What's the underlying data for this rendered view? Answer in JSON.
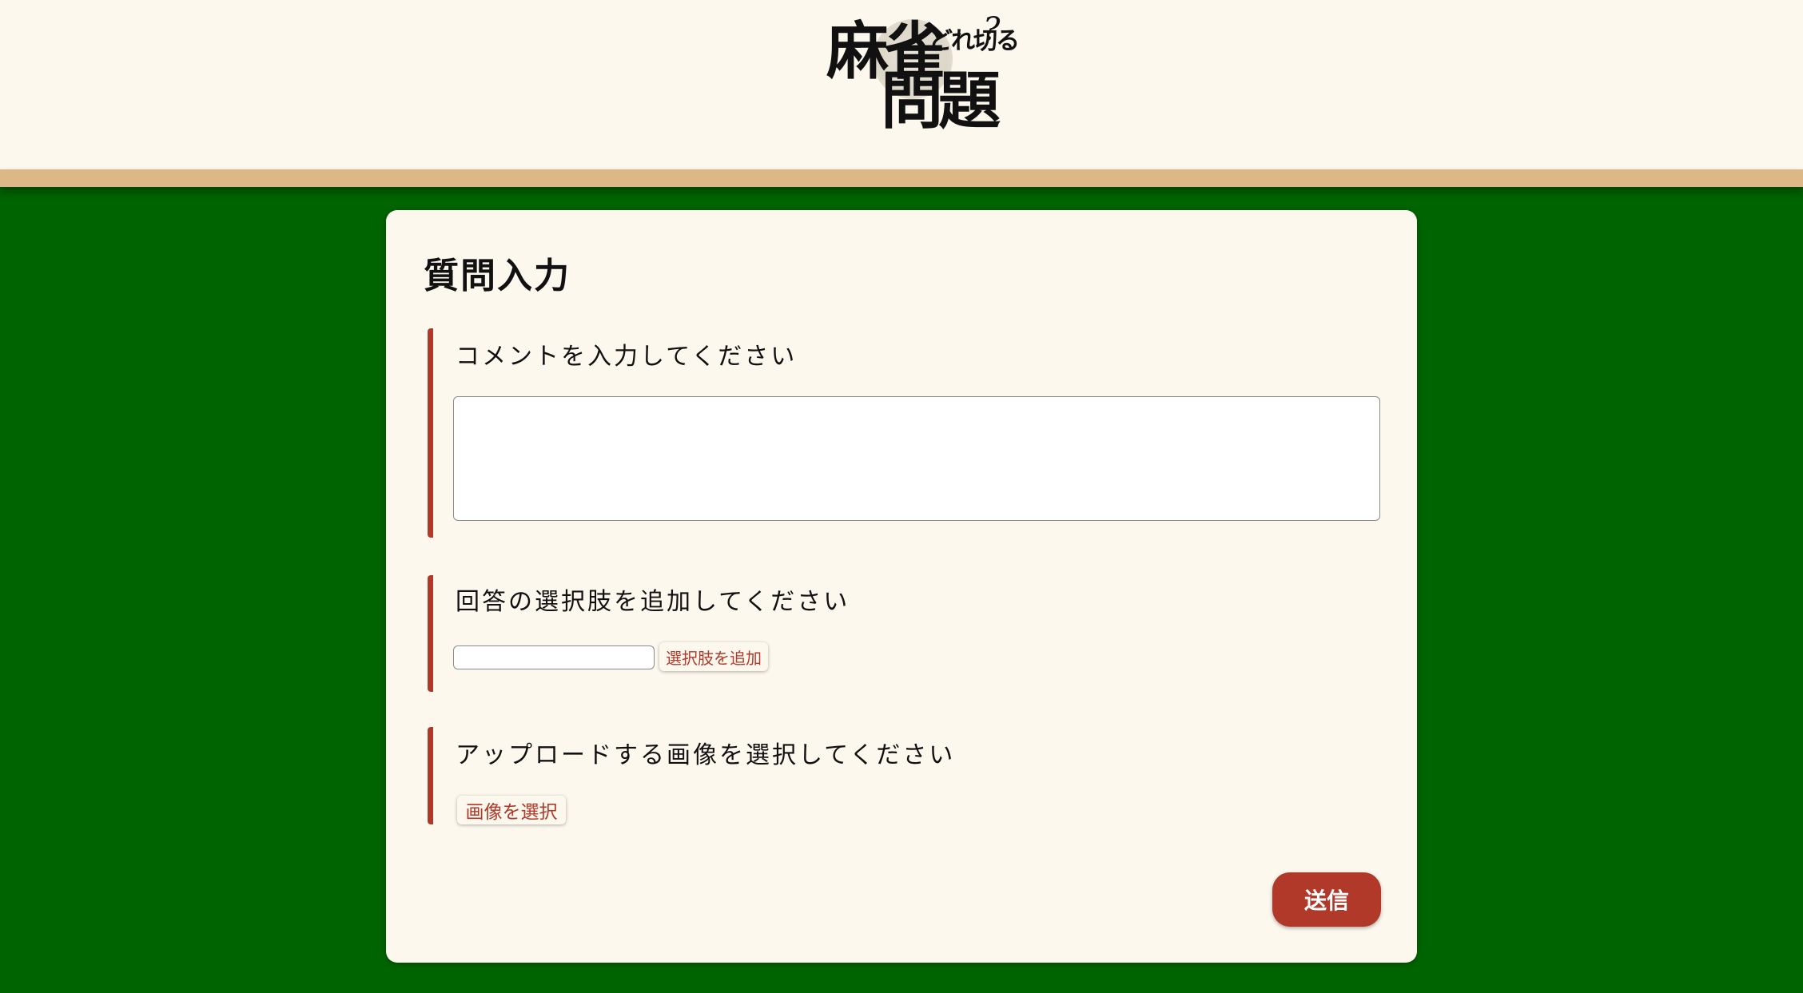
{
  "header": {
    "logo": {
      "line1": "麻雀",
      "line2": "問題",
      "tagline": "どれ切る",
      "question_mark": "?"
    }
  },
  "form": {
    "title": "質問入力",
    "comment": {
      "label": "コメントを入力してください",
      "value": "",
      "placeholder": ""
    },
    "choices": {
      "label": "回答の選択肢を追加してください",
      "input_value": "",
      "add_button": "選択肢を追加"
    },
    "image": {
      "label": "アップロードする画像を選択してください",
      "select_button": "画像を選択"
    },
    "submit_button": "送信"
  },
  "colors": {
    "background_green": "#006400",
    "header_cream": "#fdf8ee",
    "header_band_tan": "#ddb887",
    "accent_red": "#b0392a"
  }
}
